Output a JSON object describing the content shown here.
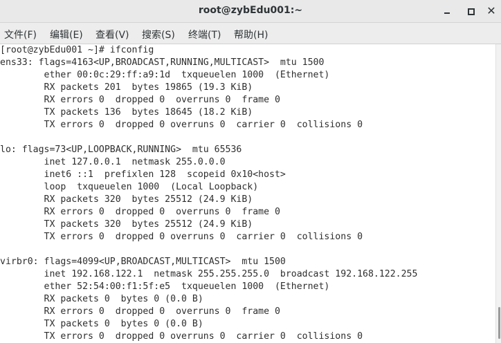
{
  "window": {
    "title": "root@zybEdu001:~",
    "minimize_symbol": "",
    "close_symbol": "✕"
  },
  "menu": {
    "file": "文件(F)",
    "edit": "编辑(E)",
    "view": "查看(V)",
    "search": "搜索(S)",
    "terminal": "终端(T)",
    "help": "帮助(H)"
  },
  "terminal": {
    "lines": [
      "[root@zybEdu001 ~]# ifconfig",
      "ens33: flags=4163<UP,BROADCAST,RUNNING,MULTICAST>  mtu 1500",
      "        ether 00:0c:29:ff:a9:1d  txqueuelen 1000  (Ethernet)",
      "        RX packets 201  bytes 19865 (19.3 KiB)",
      "        RX errors 0  dropped 0  overruns 0  frame 0",
      "        TX packets 136  bytes 18645 (18.2 KiB)",
      "        TX errors 0  dropped 0 overruns 0  carrier 0  collisions 0",
      "",
      "lo: flags=73<UP,LOOPBACK,RUNNING>  mtu 65536",
      "        inet 127.0.0.1  netmask 255.0.0.0",
      "        inet6 ::1  prefixlen 128  scopeid 0x10<host>",
      "        loop  txqueuelen 1000  (Local Loopback)",
      "        RX packets 320  bytes 25512 (24.9 KiB)",
      "        RX errors 0  dropped 0  overruns 0  frame 0",
      "        TX packets 320  bytes 25512 (24.9 KiB)",
      "        TX errors 0  dropped 0 overruns 0  carrier 0  collisions 0",
      "",
      "virbr0: flags=4099<UP,BROADCAST,MULTICAST>  mtu 1500",
      "        inet 192.168.122.1  netmask 255.255.255.0  broadcast 192.168.122.255",
      "        ether 52:54:00:f1:5f:e5  txqueuelen 1000  (Ethernet)",
      "        RX packets 0  bytes 0 (0.0 B)",
      "        RX errors 0  dropped 0  overruns 0  frame 0",
      "        TX packets 0  bytes 0 (0.0 B)",
      "        TX errors 0  dropped 0 overruns 0  carrier 0  collisions 0"
    ]
  }
}
